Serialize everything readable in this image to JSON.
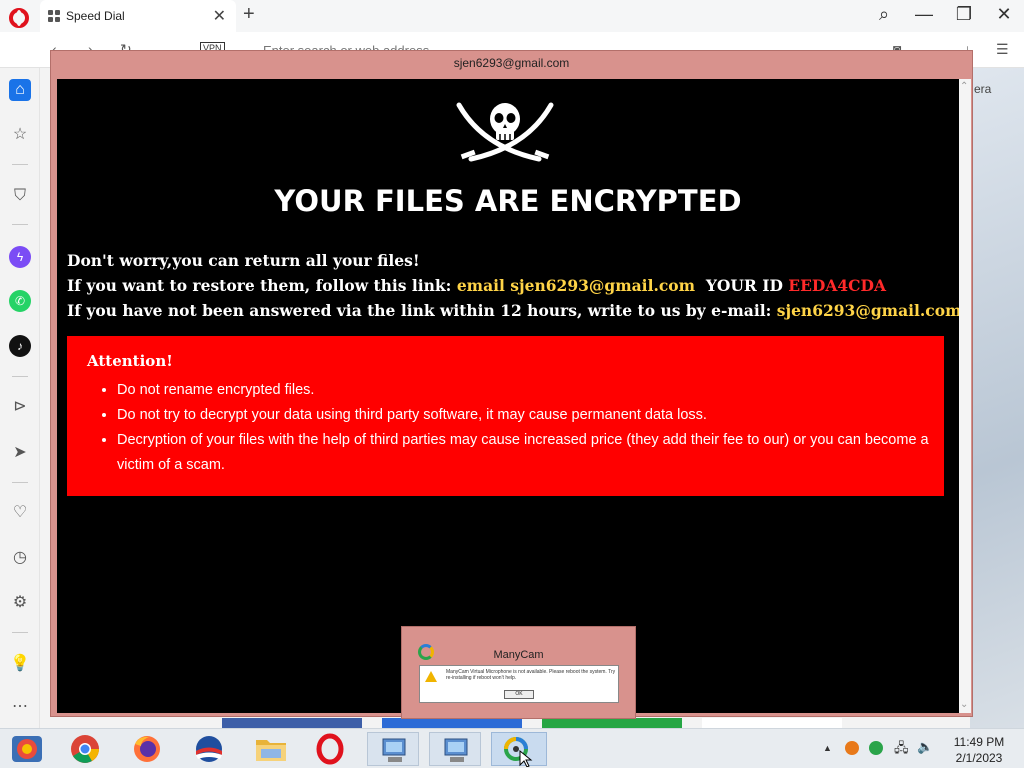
{
  "browser": {
    "tab_title": "Speed Dial",
    "tab_close": "✕",
    "new_tab": "+",
    "address_placeholder": "Enter search or web address",
    "vpn_label": "VPN",
    "minimize": "—",
    "maximize": "❐",
    "close": "✕",
    "speed_dial_partial": "era"
  },
  "ransom_window": {
    "title": "sjen6293@gmail.com",
    "headline": "YOUR FILES ARE ENCRYPTED",
    "line1": "Don't worry,you can return all your files!",
    "line2_prefix": "If you want to restore them, follow this link:",
    "line2_email": "email sjen6293@gmail.com",
    "line2_id_label": "YOUR ID",
    "line2_id_value": "EEDA4CDA",
    "line3_prefix": "If you have not been answered via the link within 12 hours, write to us by e-mail:",
    "line3_email": "sjen6293@gmail.com",
    "attention_title": "Attention!",
    "attention_items": [
      "Do not rename encrypted files.",
      "Do not try to decrypt your data using third party software, it may cause permanent data loss.",
      "Decryption of your files with the help of third parties may cause increased price (they add their fee to our) or you can become a victim of a scam."
    ]
  },
  "manycam_dialog": {
    "title": "ManyCam",
    "message": "ManyCam Virtual Microphone is not available. Please reboot the system. Try re-installing if reboot won't help.",
    "ok_label": "OK"
  },
  "taskbar": {
    "time": "11:49 PM",
    "date": "2/1/2023"
  },
  "colors": {
    "window_frame": "#d8928d",
    "attention_bg": "#ff0000",
    "email_gold": "#ffd447",
    "id_red": "#ff2a2a",
    "opera_red": "#e0121d"
  }
}
